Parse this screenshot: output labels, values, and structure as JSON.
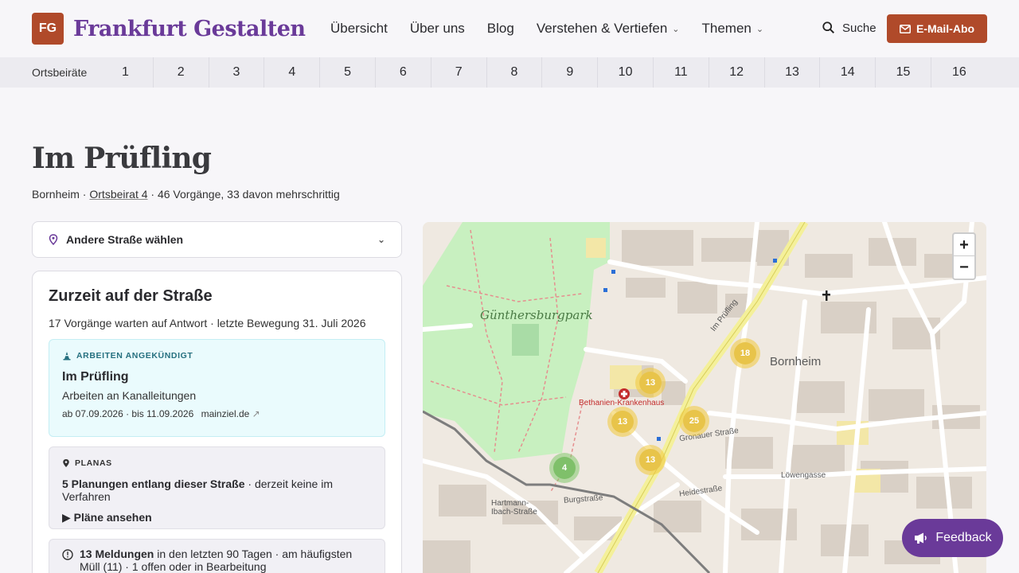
{
  "header": {
    "logo_badge": "FG",
    "logo_text": "Frankfurt Gestalten",
    "nav": [
      {
        "label": "Übersicht",
        "has_menu": false
      },
      {
        "label": "Über uns",
        "has_menu": false
      },
      {
        "label": "Blog",
        "has_menu": false
      },
      {
        "label": "Verstehen & Vertiefen",
        "has_menu": true
      },
      {
        "label": "Themen",
        "has_menu": true
      }
    ],
    "search_label": "Suche",
    "subscribe_label": "E-Mail-Abo",
    "accent_color": "#b04a2a",
    "brand_color": "#6a3a99"
  },
  "ortsbeiraete": {
    "label": "Ortsbeiräte",
    "numbers": [
      "1",
      "2",
      "3",
      "4",
      "5",
      "6",
      "7",
      "8",
      "9",
      "10",
      "11",
      "12",
      "13",
      "14",
      "15",
      "16"
    ]
  },
  "page": {
    "title": "Im Prüfling",
    "district": "Bornheim",
    "ortsbeirat_link": "Ortsbeirat 4",
    "stats": "46 Vorgänge, 33 davon mehrschrittig"
  },
  "street_select": {
    "label": "Andere Straße wählen"
  },
  "current": {
    "title": "Zurzeit auf der Straße",
    "summary": "17 Vorgänge warten auf Antwort · letzte Bewegung 31. Juli 2026",
    "works": {
      "tag": "ARBEITEN ANGEKÜNDIGT",
      "heading": "Im Prüfling",
      "description": "Arbeiten an Kanalleitungen",
      "dates": "ab 07.09.2026 · bis 11.09.2026",
      "source": "mainziel.de"
    },
    "planas": {
      "tag": "PLANAS",
      "count_text": "5 Planungen entlang dieser Straße",
      "status_text": "· derzeit keine im Verfahren",
      "toggle": "Pläne ansehen"
    },
    "reports": {
      "count_text": "13 Meldungen",
      "rest_text": "in den letzten 90 Tagen · am häufigsten Müll (11) · 1 offen oder in Bearbeitung"
    }
  },
  "map": {
    "labels": {
      "park": "Günthersburgpark",
      "district": "Bornheim",
      "street1": "Im Prüfling",
      "hospital": "Bethanien-Krankenhaus",
      "burgstrasse": "Burgstraße",
      "hartmann": "Hartmann-Ibach-Straße",
      "heidestrasse": "Heidestraße",
      "lowengasse": "Löwengasse",
      "gronauer": "Gronauer Straße"
    },
    "clusters": [
      {
        "count": "18",
        "kind": "yellow"
      },
      {
        "count": "13",
        "kind": "yellow"
      },
      {
        "count": "13",
        "kind": "yellow"
      },
      {
        "count": "25",
        "kind": "yellow"
      },
      {
        "count": "13",
        "kind": "yellow"
      },
      {
        "count": "4",
        "kind": "green"
      }
    ],
    "zoom_in": "+",
    "zoom_out": "−"
  },
  "feedback": {
    "label": "Feedback"
  }
}
